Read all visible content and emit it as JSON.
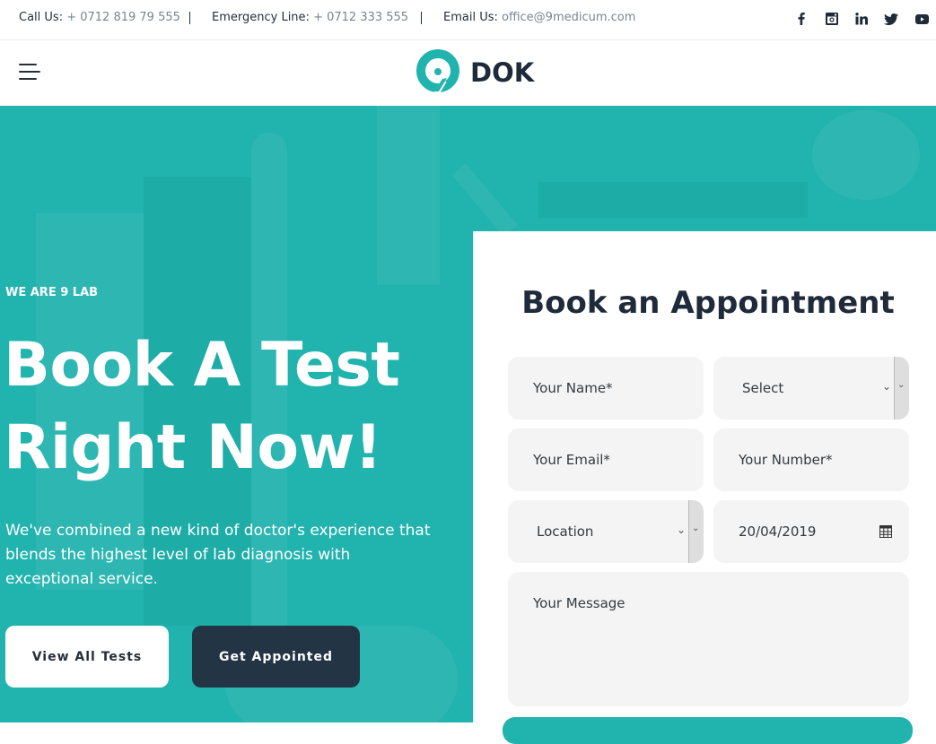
{
  "topbar": {
    "call": {
      "label": "Call Us:",
      "value": "+ 0712 819 79 555"
    },
    "emergency": {
      "label": "Emergency Line:",
      "value": "+ 0712 333 555"
    },
    "email": {
      "label": "Email Us:",
      "value": "office@9medicum.com"
    },
    "social": [
      "facebook-icon",
      "instagram-icon",
      "linkedin-icon",
      "twitter-icon",
      "youtube-icon"
    ]
  },
  "nav": {
    "logo_text": "DOK",
    "menu_icon": "hamburger-menu-icon"
  },
  "hero": {
    "eyebrow": "WE ARE 9 LAB",
    "headline_line1": "Book A Test",
    "headline_line2": "Right Now!",
    "lead": "We've combined a new kind of doctor's experience that blends the highest level of lab diagnosis with exceptional service.",
    "buttons": {
      "view_all": "View All Tests",
      "get_appointed": "Get Appointed"
    },
    "bg_color": "#21b3ae"
  },
  "form": {
    "title": "Book an Appointment",
    "name_placeholder": "Your Name*",
    "select_value": "Select",
    "email_placeholder": "Your Email*",
    "number_placeholder": "Your Number*",
    "location_value": "Location",
    "date_value": "20/04/2019",
    "message_placeholder": "Your Message"
  },
  "colors": {
    "accent": "#21b3ae",
    "dark": "#233444",
    "text": "#252f3a",
    "muted": "#7b858d",
    "field_bg": "#f4f4f4"
  }
}
